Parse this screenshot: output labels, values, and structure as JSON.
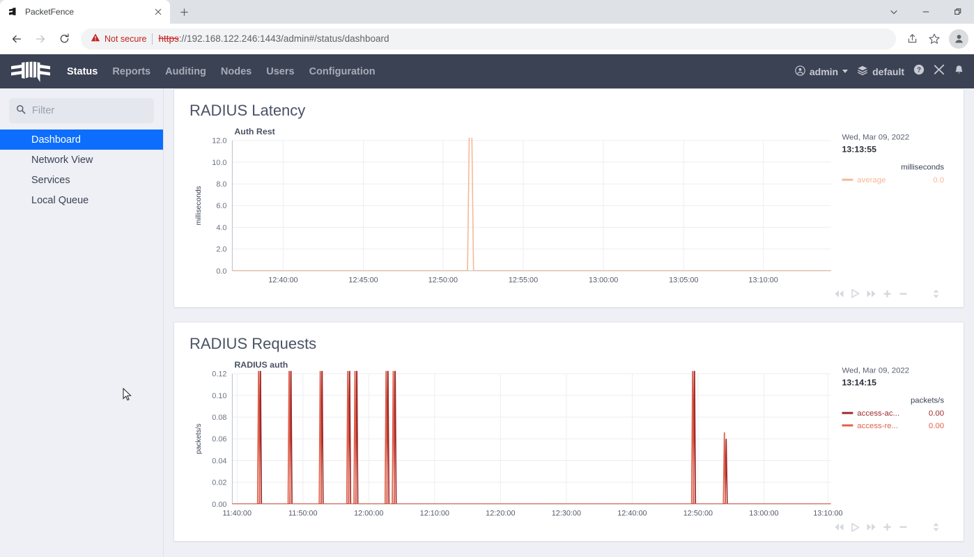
{
  "browser": {
    "tab": {
      "title": "PacketFence",
      "favicon_icon": "packetfence-favicon",
      "close_icon": "close-icon"
    },
    "new_tab_icon": "plus-icon",
    "window_controls": [
      {
        "name": "chevron-down-button",
        "icon": "chevron-down-icon"
      },
      {
        "name": "minimize-button",
        "icon": "minimize-icon"
      },
      {
        "name": "restore-button",
        "icon": "restore-icon"
      }
    ],
    "toolbar": {
      "back_icon": "arrow-left-icon",
      "forward_icon": "arrow-right-icon",
      "reload_icon": "reload-icon",
      "warning_icon": "warning-triangle-icon",
      "security_label": "Not secure",
      "url_scheme": "https",
      "url_rest": "://192.168.122.246:1443/admin#/status/dashboard",
      "url_host": "192.168.122.246:1443",
      "url_path": "/admin#/status/dashboard",
      "share_icon": "share-icon",
      "bookmark_icon": "star-icon",
      "profile_icon": "profile-avatar-icon"
    }
  },
  "appbar": {
    "logo_name": "packetfence-logo",
    "nav": [
      {
        "label": "Status",
        "active": true
      },
      {
        "label": "Reports",
        "active": false
      },
      {
        "label": "Auditing",
        "active": false
      },
      {
        "label": "Nodes",
        "active": false
      },
      {
        "label": "Users",
        "active": false
      },
      {
        "label": "Configuration",
        "active": false
      }
    ],
    "user": {
      "label": "admin",
      "icon": "user-circle-icon"
    },
    "tenant": {
      "label": "default",
      "icon": "layers-icon"
    },
    "help_icon": "question-circle-icon",
    "tools_icon": "tools-icon",
    "bell_icon": "bell-icon"
  },
  "sidebar": {
    "filter": {
      "placeholder": "Filter",
      "value": "",
      "icon": "search-icon"
    },
    "items": [
      {
        "label": "Dashboard",
        "active": true
      },
      {
        "label": "Network View",
        "active": false
      },
      {
        "label": "Services",
        "active": false
      },
      {
        "label": "Local Queue",
        "active": false
      }
    ]
  },
  "graph_controls": {
    "rewind_icon": "rewind-icon",
    "play_icon": "play-icon",
    "forward_icon": "fast-forward-icon",
    "zoom_in_icon": "plus-icon",
    "zoom_out_icon": "minus-icon",
    "resize_icon": "updown-arrows-icon"
  },
  "chart_data": [
    {
      "type": "line",
      "card_title": "RADIUS Latency",
      "title": "Auth Rest",
      "xlabel": "",
      "ylabel": "milliseconds",
      "ylim": [
        0.0,
        12.0
      ],
      "yticks": [
        "0.0",
        "2.0",
        "4.0",
        "6.0",
        "8.0",
        "10.0",
        "12.0"
      ],
      "ytick_values": [
        0.0,
        2.0,
        4.0,
        6.0,
        8.0,
        10.0,
        12.0
      ],
      "xticks": [
        "12:40:00",
        "12:45:00",
        "12:50:00",
        "12:55:00",
        "13:00:00",
        "13:05:00",
        "13:10:00"
      ],
      "xtick_positions": [
        0.085,
        0.219,
        0.352,
        0.486,
        0.62,
        0.754,
        0.887
      ],
      "grid": true,
      "timestamp_date": "Wed, Mar 09, 2022",
      "timestamp_time": "13:13:55",
      "legend_units": "milliseconds",
      "legend_position": "right",
      "series": [
        {
          "name": "average",
          "display_name": "average",
          "value": "0.0",
          "color": "#f5b895",
          "points": [
            [
              0.0,
              0.0
            ],
            [
              0.38,
              0.0
            ],
            [
              0.393,
              0.0
            ],
            [
              0.396,
              13.2
            ],
            [
              0.4,
              13.2
            ],
            [
              0.403,
              0.0
            ],
            [
              0.42,
              0.0
            ],
            [
              1.0,
              0.0
            ]
          ]
        }
      ]
    },
    {
      "type": "line",
      "card_title": "RADIUS Requests",
      "title": "RADIUS auth",
      "xlabel": "",
      "ylabel": "packets/s",
      "ylim": [
        0.0,
        0.12
      ],
      "yticks": [
        "0.00",
        "0.02",
        "0.04",
        "0.06",
        "0.08",
        "0.10",
        "0.12"
      ],
      "ytick_values": [
        0.0,
        0.02,
        0.04,
        0.06,
        0.08,
        0.1,
        0.12
      ],
      "xticks": [
        "11:40:00",
        "11:50:00",
        "12:00:00",
        "12:10:00",
        "12:20:00",
        "12:30:00",
        "12:40:00",
        "12:50:00",
        "13:00:00",
        "13:10:00"
      ],
      "xtick_positions": [
        0.008,
        0.118,
        0.228,
        0.338,
        0.448,
        0.558,
        0.668,
        0.778,
        0.888,
        0.995
      ],
      "grid": true,
      "timestamp_date": "Wed, Mar 09, 2022",
      "timestamp_time": "13:14:15",
      "legend_units": "packets/s",
      "legend_position": "right",
      "series": [
        {
          "name": "access-accept",
          "display_name": "access-ac...",
          "value": "0.00",
          "color": "#9e2a2b",
          "spikes": [
            [
              0.047,
              0.135
            ],
            [
              0.098,
              0.135
            ],
            [
              0.15,
              0.135
            ],
            [
              0.196,
              0.135
            ],
            [
              0.208,
              0.135
            ],
            [
              0.26,
              0.135
            ],
            [
              0.272,
              0.135
            ],
            [
              0.772,
              0.135
            ],
            [
              0.825,
              0.06
            ]
          ]
        },
        {
          "name": "access-request",
          "display_name": "access-re...",
          "value": "0.00",
          "color": "#e0604a",
          "spikes": [
            [
              0.044,
              0.135
            ],
            [
              0.095,
              0.135
            ],
            [
              0.147,
              0.135
            ],
            [
              0.193,
              0.135
            ],
            [
              0.205,
              0.135
            ],
            [
              0.257,
              0.135
            ],
            [
              0.269,
              0.135
            ],
            [
              0.769,
              0.135
            ],
            [
              0.822,
              0.066
            ]
          ]
        }
      ]
    }
  ]
}
